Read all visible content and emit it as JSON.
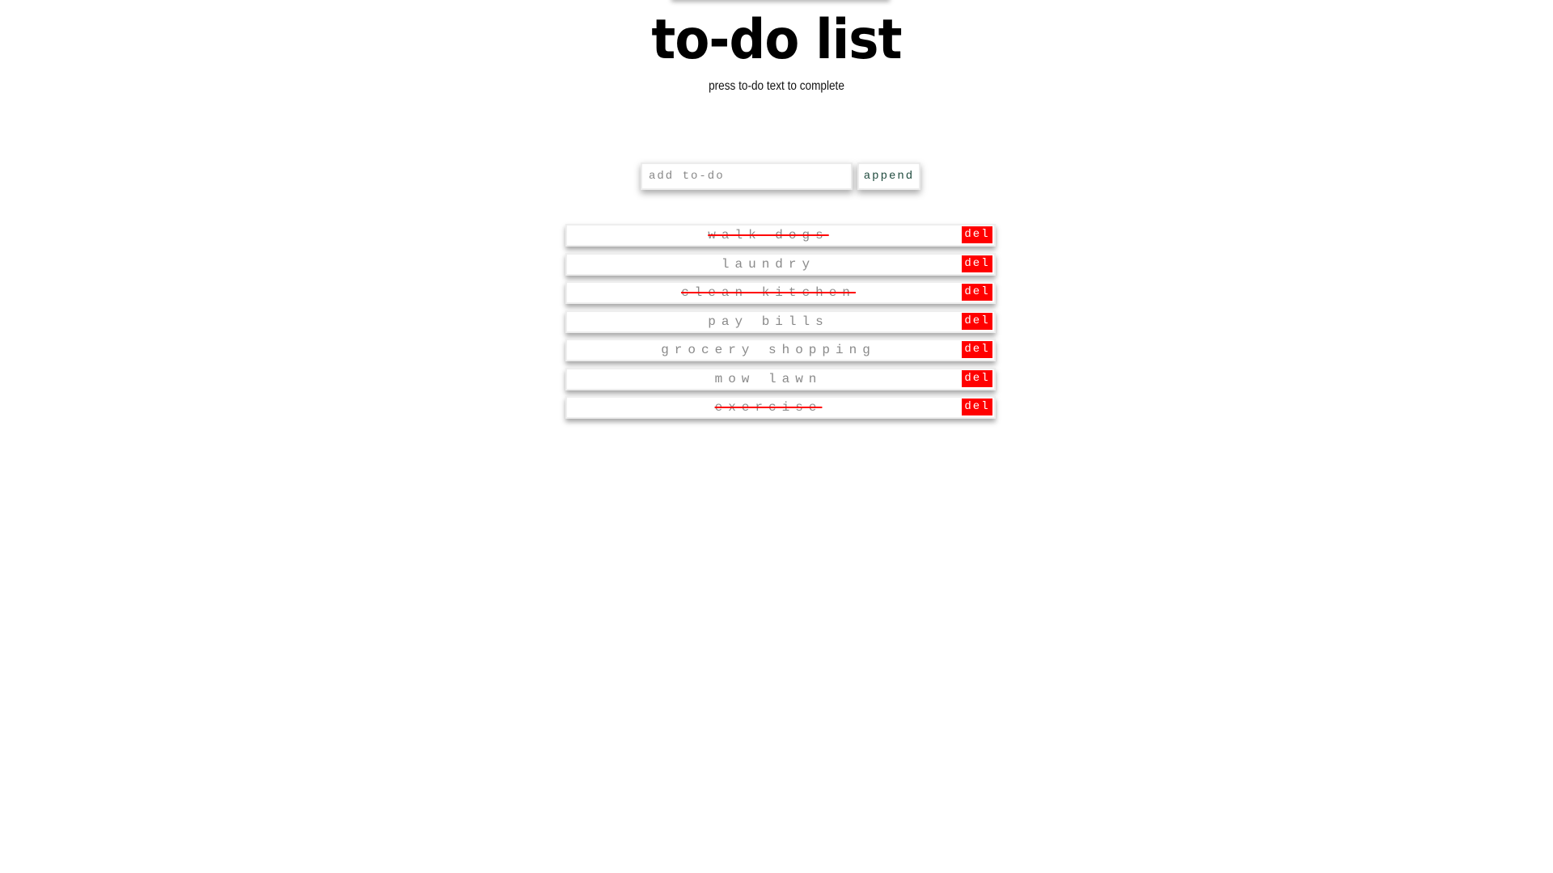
{
  "header": {
    "title": "to-do list",
    "subtitle": "press to-do text to complete"
  },
  "input": {
    "placeholder": "add to-do",
    "value": "",
    "append_label": "append"
  },
  "todos": [
    {
      "text": "walk dogs",
      "completed": true,
      "del_label": "del"
    },
    {
      "text": "laundry",
      "completed": false,
      "del_label": "del"
    },
    {
      "text": "clean kitchen",
      "completed": true,
      "del_label": "del"
    },
    {
      "text": "pay bills",
      "completed": false,
      "del_label": "del"
    },
    {
      "text": "grocery shopping",
      "completed": false,
      "del_label": "del"
    },
    {
      "text": "mow lawn",
      "completed": false,
      "del_label": "del"
    },
    {
      "text": "exercise",
      "completed": true,
      "del_label": "del"
    }
  ],
  "colors": {
    "delete_button": "#ff0000",
    "strikethrough": "#ff0000",
    "append_text": "#1f4a3d"
  }
}
